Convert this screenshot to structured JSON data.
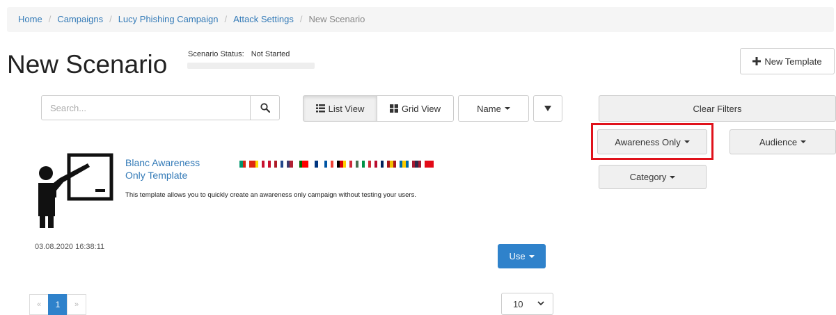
{
  "breadcrumb": {
    "items": [
      "Home",
      "Campaigns",
      "Lucy Phishing Campaign",
      "Attack Settings"
    ],
    "active": "New Scenario",
    "separator": "/"
  },
  "page": {
    "title": "New Scenario",
    "status_label": "Scenario Status:",
    "status_value": "Not Started"
  },
  "toolbar": {
    "new_template_label": "New Template",
    "search_placeholder": "Search...",
    "list_view_label": "List View",
    "grid_view_label": "Grid View",
    "sort_label": "Name"
  },
  "filters": {
    "clear_label": "Clear Filters",
    "awareness_label": "Awareness Only",
    "audience_label": "Audience",
    "category_label": "Category"
  },
  "template": {
    "title": "Blanc Awareness Only Template",
    "description": "This template allows you to quickly create an awareness only campaign without testing your users.",
    "date": "03.08.2020 16:38:11",
    "use_label": "Use",
    "icon": "teacher-presentation-icon",
    "flags": [
      [
        "#ffffff",
        "#00966e",
        "#d62612"
      ],
      [
        "#de2910",
        "#de2910",
        "#ffde00"
      ],
      [
        "#c8102e",
        "#ffffff",
        "#c8102e"
      ],
      [
        "#ae1c28",
        "#ffffff",
        "#21468b"
      ],
      [
        "#3c3b6e",
        "#b22234",
        "#ffffff"
      ],
      [
        "#006600",
        "#ff0000",
        "#ff0000"
      ],
      [
        "#ffffff",
        "#003580",
        "#ffffff"
      ],
      [
        "#0055a4",
        "#ffffff",
        "#ef4135"
      ],
      [
        "#000000",
        "#dd0000",
        "#ffce00"
      ],
      [
        "#ce2939",
        "#ffffff",
        "#477050"
      ],
      [
        "#009246",
        "#ffffff",
        "#ce2b37"
      ],
      [
        "#ba0c2f",
        "#ffffff",
        "#00205b"
      ],
      [
        "#aa151b",
        "#f1bf00",
        "#aa151b"
      ],
      [
        "#006aa7",
        "#fecc00",
        "#006aa7"
      ],
      [
        "#a51931",
        "#2d2a4a",
        "#a51931"
      ],
      [
        "#e30a17",
        "#e30a17",
        "#e30a17"
      ]
    ]
  },
  "pagination": {
    "prev": "«",
    "current": "1",
    "next": "»",
    "per_page": "10"
  },
  "colors": {
    "primary": "#2f82cb",
    "link": "#337ab7",
    "highlight": "#e0121b"
  }
}
